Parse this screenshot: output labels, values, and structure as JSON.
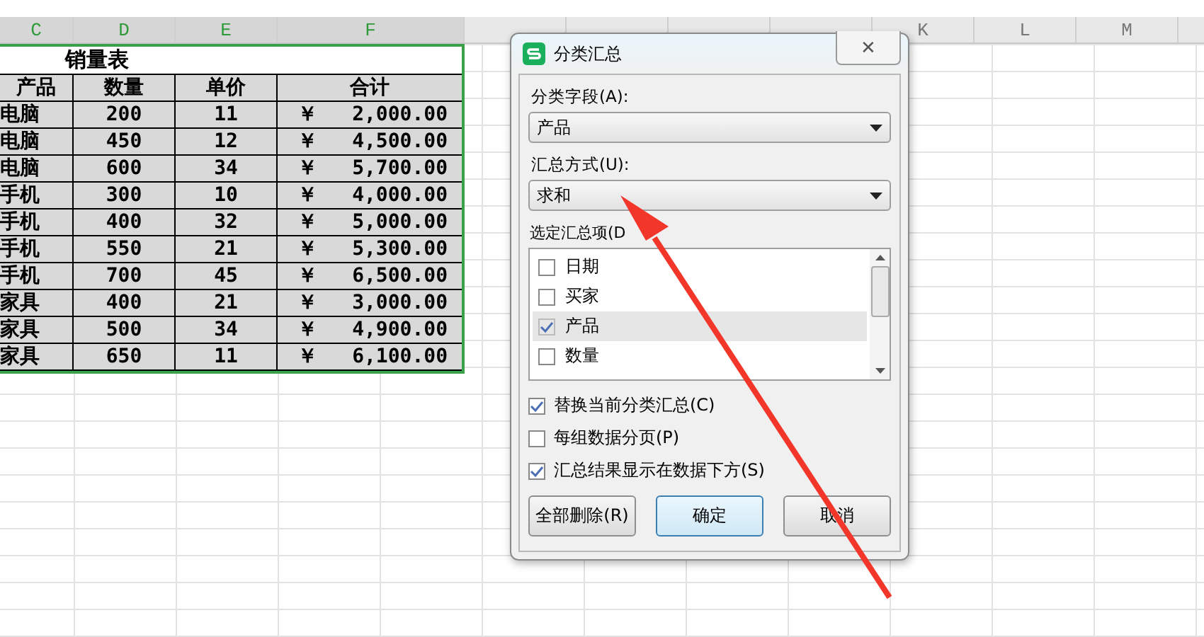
{
  "columns": [
    {
      "label": "C",
      "selected": true
    },
    {
      "label": "D",
      "selected": true
    },
    {
      "label": "E",
      "selected": true
    },
    {
      "label": "F",
      "selected": true
    },
    {
      "label": "K",
      "selected": false
    },
    {
      "label": "L",
      "selected": false
    },
    {
      "label": "M",
      "selected": false
    }
  ],
  "table": {
    "title": "销量表",
    "headers": [
      "产品",
      "数量",
      "单价",
      "合计"
    ],
    "rows": [
      {
        "product": "电脑",
        "qty": "200",
        "price": "11",
        "currency": "￥",
        "total": "2,000.00"
      },
      {
        "product": "电脑",
        "qty": "450",
        "price": "12",
        "currency": "￥",
        "total": "4,500.00"
      },
      {
        "product": "电脑",
        "qty": "600",
        "price": "34",
        "currency": "￥",
        "total": "5,700.00"
      },
      {
        "product": "手机",
        "qty": "300",
        "price": "10",
        "currency": "￥",
        "total": "4,000.00"
      },
      {
        "product": "手机",
        "qty": "400",
        "price": "32",
        "currency": "￥",
        "total": "5,000.00"
      },
      {
        "product": "手机",
        "qty": "550",
        "price": "21",
        "currency": "￥",
        "total": "5,300.00"
      },
      {
        "product": "手机",
        "qty": "700",
        "price": "45",
        "currency": "￥",
        "total": "6,500.00"
      },
      {
        "product": "家具",
        "qty": "400",
        "price": "21",
        "currency": "￥",
        "total": "3,000.00"
      },
      {
        "product": "家具",
        "qty": "500",
        "price": "34",
        "currency": "￥",
        "total": "4,900.00"
      },
      {
        "product": "家具",
        "qty": "650",
        "price": "11",
        "currency": "￥",
        "total": "6,100.00"
      }
    ]
  },
  "dialog": {
    "title": "分类汇总",
    "close": "✕",
    "field_label": "分类字段(A):",
    "field_value": "产品",
    "method_label": "汇总方式(U):",
    "method_value": "求和",
    "items_label": "选定汇总项(D",
    "items": [
      {
        "label": "日期",
        "checked": false,
        "selected": false
      },
      {
        "label": "买家",
        "checked": false,
        "selected": false
      },
      {
        "label": "产品",
        "checked": true,
        "selected": true
      },
      {
        "label": "数量",
        "checked": false,
        "selected": false
      }
    ],
    "options": [
      {
        "label": "替换当前分类汇总(C)",
        "checked": true
      },
      {
        "label": "每组数据分页(P)",
        "checked": false
      },
      {
        "label": "汇总结果显示在数据下方(S)",
        "checked": true
      }
    ],
    "buttons": [
      {
        "label": "全部删除(R)",
        "kind": "normal"
      },
      {
        "label": "确定",
        "kind": "default"
      },
      {
        "label": "取消",
        "kind": "normal"
      }
    ]
  }
}
